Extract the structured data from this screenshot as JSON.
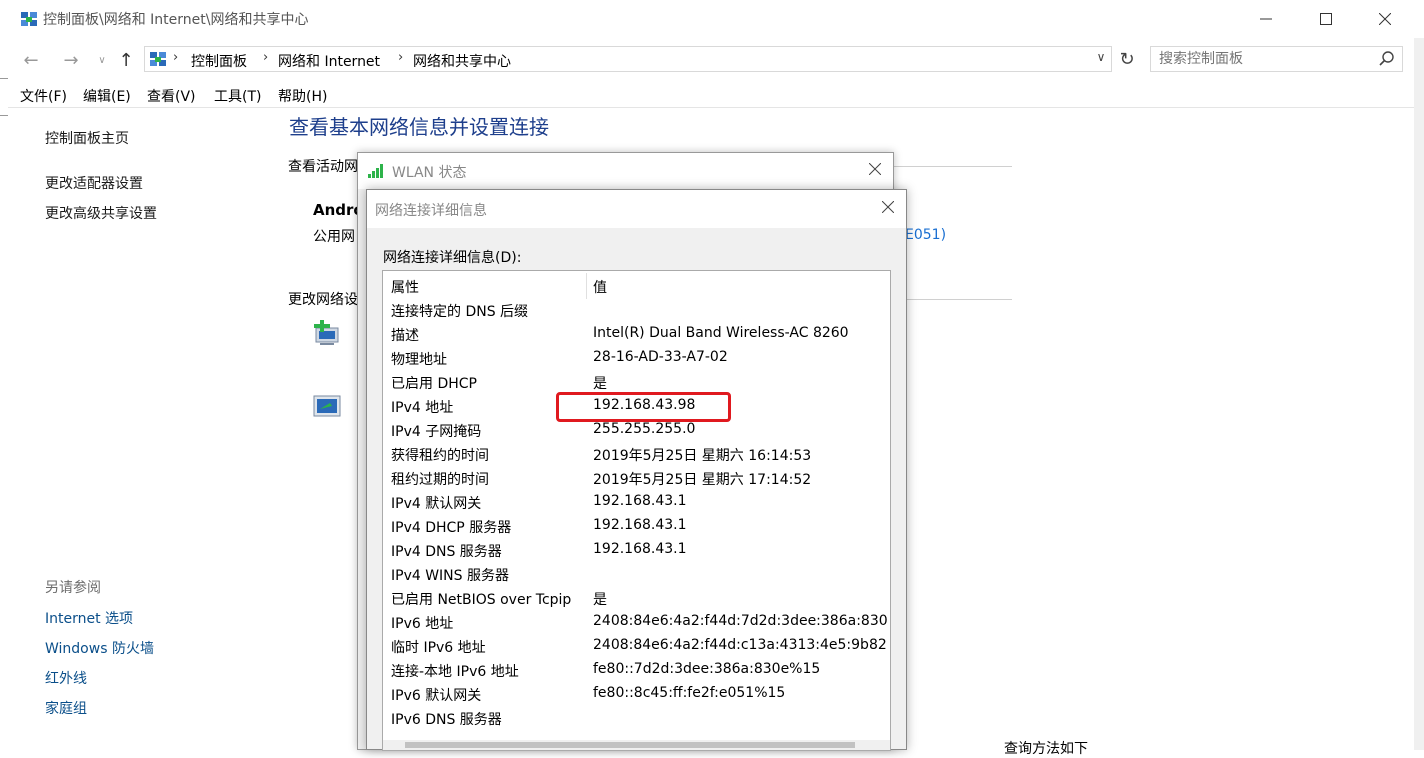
{
  "window": {
    "title": "控制面板\\网络和 Internet\\网络和共享中心"
  },
  "breadcrumb": {
    "items": [
      "控制面板",
      "网络和 Internet",
      "网络和共享中心"
    ]
  },
  "search": {
    "placeholder": "搜索控制面板"
  },
  "menu": {
    "items": [
      "文件(F)",
      "编辑(E)",
      "查看(V)",
      "工具(T)",
      "帮助(H)"
    ]
  },
  "sidebar": {
    "items": [
      "控制面板主页",
      "更改适配器设置",
      "更改高级共享设置"
    ],
    "see_also_label": "另请参阅",
    "see_also": [
      "Internet 选项",
      "Windows 防火墙",
      "红外线",
      "家庭组"
    ]
  },
  "main": {
    "title": "查看基本网络信息并设置连接",
    "active_networks_label": "查看活动网",
    "network_name": "Andro",
    "network_type": "公用网",
    "connection_link": "E051)",
    "change_settings_label": "更改网络设",
    "bottom_text": "查询方法如下"
  },
  "wlan_dialog": {
    "title": "WLAN 状态"
  },
  "details_dialog": {
    "title": "网络连接详细信息",
    "label": "网络连接详细信息(D):",
    "columns": [
      "属性",
      "值"
    ],
    "rows": [
      {
        "prop": "连接特定的 DNS 后缀",
        "value": ""
      },
      {
        "prop": "描述",
        "value": "Intel(R) Dual Band Wireless-AC 8260"
      },
      {
        "prop": "物理地址",
        "value": "28-16-AD-33-A7-02"
      },
      {
        "prop": "已启用 DHCP",
        "value": "是"
      },
      {
        "prop": "IPv4 地址",
        "value": "192.168.43.98"
      },
      {
        "prop": "IPv4 子网掩码",
        "value": "255.255.255.0"
      },
      {
        "prop": "获得租约的时间",
        "value": "2019年5月25日 星期六 16:14:53"
      },
      {
        "prop": "租约过期的时间",
        "value": "2019年5月25日 星期六 17:14:52"
      },
      {
        "prop": "IPv4 默认网关",
        "value": "192.168.43.1"
      },
      {
        "prop": "IPv4 DHCP 服务器",
        "value": "192.168.43.1"
      },
      {
        "prop": "IPv4 DNS 服务器",
        "value": "192.168.43.1"
      },
      {
        "prop": "IPv4 WINS 服务器",
        "value": ""
      },
      {
        "prop": "已启用 NetBIOS over Tcpip",
        "value": "是"
      },
      {
        "prop": "IPv6 地址",
        "value": "2408:84e6:4a2:f44d:7d2d:3dee:386a:830"
      },
      {
        "prop": "临时 IPv6 地址",
        "value": "2408:84e6:4a2:f44d:c13a:4313:4e5:9b82"
      },
      {
        "prop": "连接-本地 IPv6 地址",
        "value": "fe80::7d2d:3dee:386a:830e%15"
      },
      {
        "prop": "IPv6 默认网关",
        "value": "fe80::8c45:ff:fe2f:e051%15"
      },
      {
        "prop": "IPv6 DNS 服务器",
        "value": ""
      }
    ]
  },
  "colors": {
    "highlight_box": "#e0191f",
    "title_blue": "#1e3f8c",
    "link_blue": "#1a6fd1"
  }
}
